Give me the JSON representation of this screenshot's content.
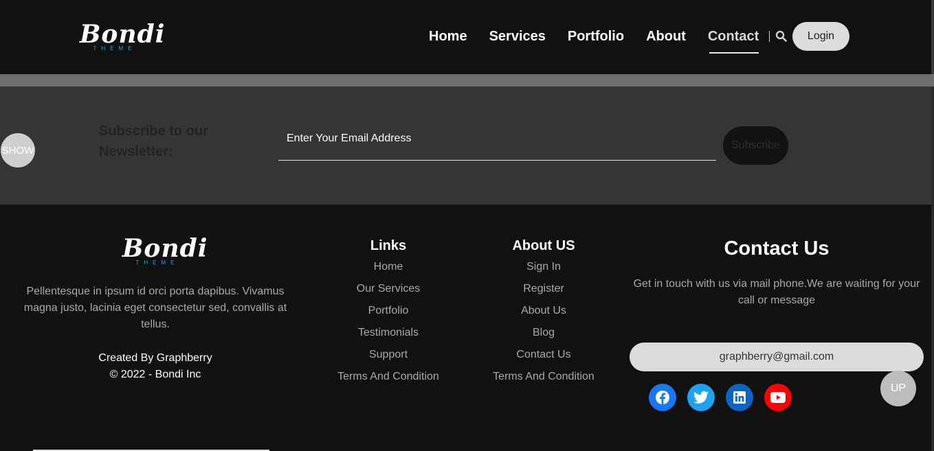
{
  "header": {
    "logo": {
      "script": "Bondi",
      "sub": "THEME"
    },
    "nav": [
      {
        "label": "Home"
      },
      {
        "label": "Services"
      },
      {
        "label": "Portfolio"
      },
      {
        "label": "About"
      },
      {
        "label": "Contact",
        "active": true
      }
    ],
    "search_icon": "search-icon",
    "login_label": "Login"
  },
  "newsletter": {
    "title": "Subscribe to our Newsletter:",
    "email_placeholder": "Enter Your Email Address",
    "subscribe_label": "Subscribe",
    "show_label": "SHOW"
  },
  "footer": {
    "logo": {
      "script": "Bondi",
      "sub": "THEME"
    },
    "about_text": "Pellentesque in ipsum id orci porta dapibus. Vivamus magna justo, lacinia eget consectetur sed, convallis at tellus.",
    "created_by": "Created By Graphberry",
    "copyright": "© 2022 - Bondi Inc",
    "links": {
      "title": "Links",
      "items": [
        "Home",
        "Our Services",
        "Portfolio",
        "Testimonials",
        "Support",
        "Terms And Condition"
      ]
    },
    "about_us": {
      "title": "About US",
      "items": [
        "Sign In",
        "Register",
        "About Us",
        "Blog",
        "Contact Us",
        "Terms And Condition"
      ]
    },
    "contact": {
      "title": "Contact Us",
      "text": "Get in touch with us via mail phone.We are waiting for your call or message",
      "email": "graphberry@gmail.com",
      "socials": [
        {
          "icon": "facebook-icon",
          "color": "#1877f2"
        },
        {
          "icon": "twitter-icon",
          "color": "#1da1f2"
        },
        {
          "icon": "linkedin-icon",
          "color": "#0a66c2"
        },
        {
          "icon": "youtube-icon",
          "color": "#ff0000"
        }
      ]
    },
    "up_label": "UP"
  },
  "colors": {
    "background": "#111111",
    "newsletter_bg": "#353535",
    "strip": "#6f6f6f",
    "logo_accent": "#1ea7d9",
    "pill": "#dcdcdc"
  }
}
